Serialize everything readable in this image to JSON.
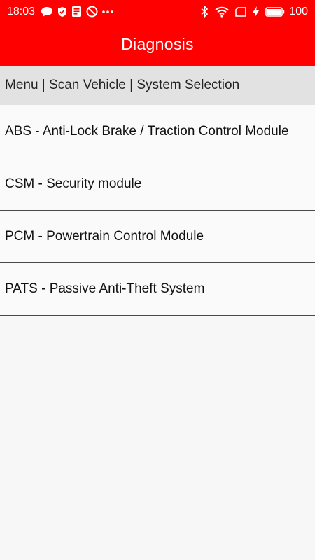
{
  "status_bar": {
    "time": "18:03",
    "battery_percent": "100",
    "left_icons": [
      "chat-bubble-icon",
      "shield-icon",
      "document-icon",
      "do-not-disturb-icon",
      "more-dots-icon"
    ],
    "right_icons": [
      "bluetooth-icon",
      "wifi-icon",
      "sim-card-icon",
      "charging-icon",
      "battery-icon"
    ]
  },
  "app_bar": {
    "title": "Diagnosis",
    "background_color": "#ff0000"
  },
  "breadcrumb": {
    "text": "Menu | Scan Vehicle | System Selection"
  },
  "systems": {
    "items": [
      {
        "label": "ABS - Anti-Lock Brake / Traction Control Module"
      },
      {
        "label": "CSM - Security module"
      },
      {
        "label": "PCM - Powertrain Control Module"
      },
      {
        "label": "PATS - Passive Anti-Theft System"
      }
    ]
  }
}
